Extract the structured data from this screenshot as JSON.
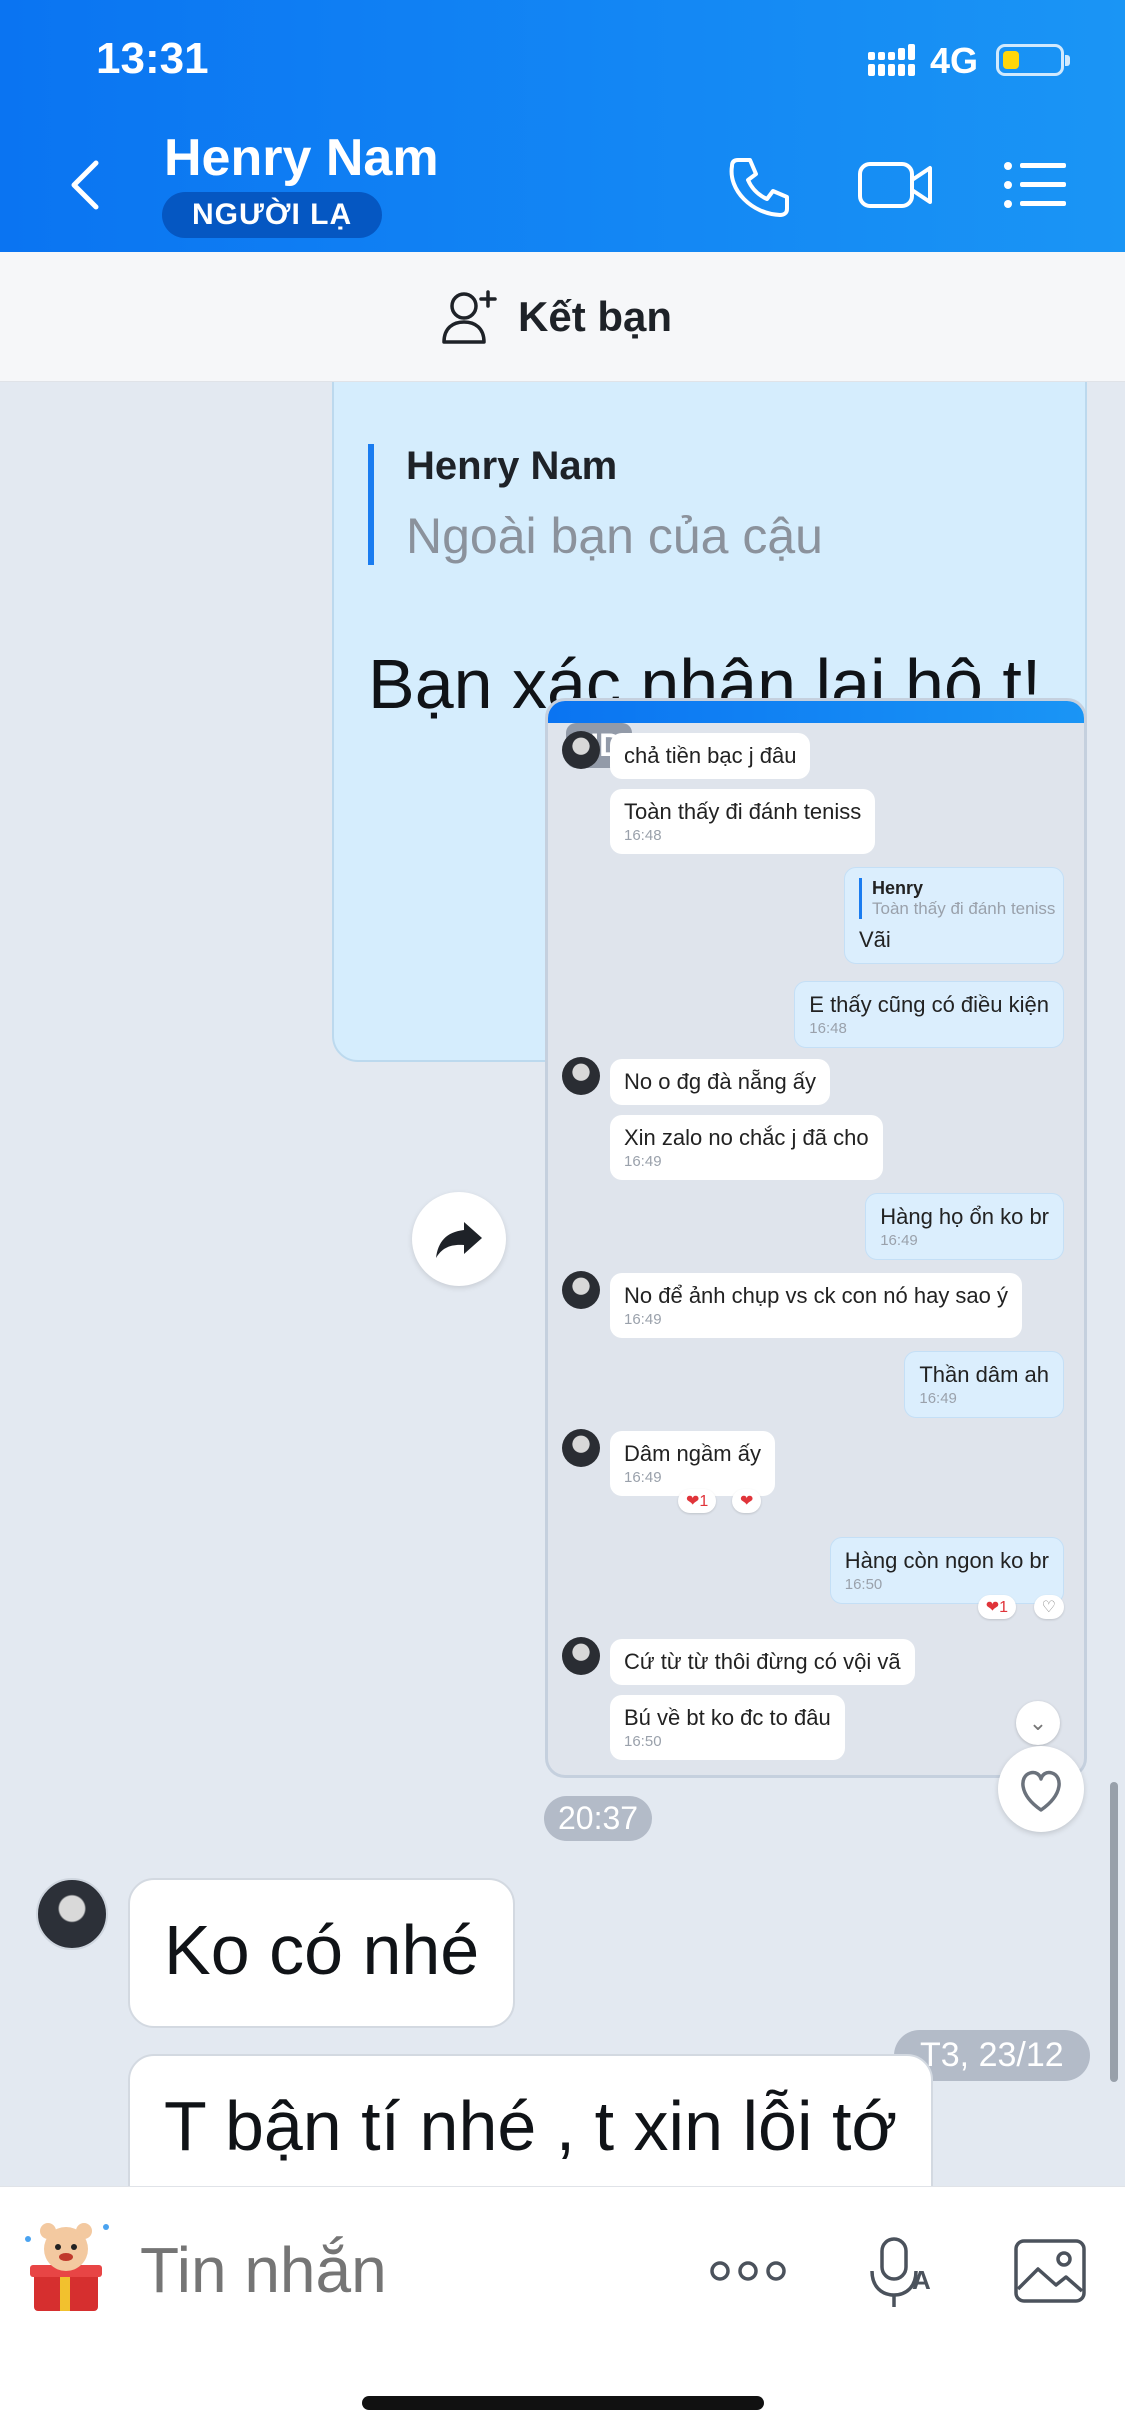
{
  "status_bar": {
    "time": "13:31",
    "network": "4G"
  },
  "header": {
    "contact_name": "Henry Nam",
    "badge": "NGƯỜI LẠ",
    "icons": [
      "back-icon",
      "phone-icon",
      "video-call-icon",
      "menu-list-icon"
    ]
  },
  "add_friend": {
    "label": "Kết bạn",
    "icon": "add-friend-icon"
  },
  "messages": {
    "outgoing_quote": {
      "quote_name": "Henry Nam",
      "quote_text": "Ngoài bạn của cậu",
      "text": "Bạn xác nhận lại hộ t!"
    },
    "image_message": {
      "badge": "HD",
      "time": "20:37",
      "embedded_chat": [
        {
          "side": "in",
          "text": "chả tiền bạc j đâu",
          "time": ""
        },
        {
          "side": "in",
          "text": "Toàn thấy đi đánh teniss",
          "time": "16:48"
        },
        {
          "side": "out",
          "quote_name": "Henry",
          "quote_text": "Toàn thấy đi đánh teniss",
          "text": "Vãi",
          "time": ""
        },
        {
          "side": "out",
          "text": "E thấy cũng có điều kiện",
          "time": "16:48"
        },
        {
          "side": "in",
          "text": "No o đg đà nẵng ấy",
          "time": ""
        },
        {
          "side": "in",
          "text": "Xin zalo no chắc j đã cho",
          "time": "16:49"
        },
        {
          "side": "out",
          "text": "Hàng họ ổn ko br",
          "time": "16:49"
        },
        {
          "side": "in",
          "text": "No để ảnh chụp vs ck con nó hay sao ý",
          "time": "16:49"
        },
        {
          "side": "out",
          "text": "Thần dâm ah",
          "time": "16:49"
        },
        {
          "side": "in",
          "text": "Dâm ngầm ấy",
          "time": "16:49",
          "reaction": "❤1"
        },
        {
          "side": "out",
          "text": "Hàng còn ngon ko br",
          "time": "16:50",
          "reaction": "❤1"
        },
        {
          "side": "in",
          "text": "Cứ từ từ thôi đừng có vội vã",
          "time": ""
        },
        {
          "side": "in",
          "text": "Bú về bt ko đc to đâu",
          "time": "16:50"
        }
      ]
    },
    "incoming": [
      {
        "text": "Ko có nhé"
      },
      {
        "text": "T bận tí nhé , t xin lỗi tớ"
      }
    ],
    "date_separator": "T3, 23/12"
  },
  "composer": {
    "placeholder": "Tin nhắn",
    "icons": [
      "sticker-icon",
      "more-icon",
      "voice-to-text-icon",
      "image-icon"
    ]
  }
}
